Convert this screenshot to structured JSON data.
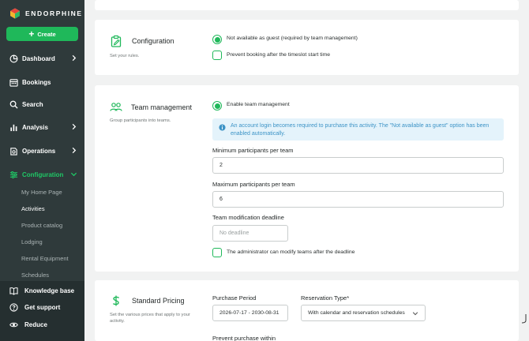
{
  "brand": {
    "name": "ENDORPHINE"
  },
  "sidebar": {
    "create_label": "Create",
    "nav": [
      {
        "label": "Dashboard",
        "icon": "dashboard-icon",
        "chevron": true
      },
      {
        "label": "Bookings",
        "icon": "calendar-icon",
        "chevron": false
      },
      {
        "label": "Search",
        "icon": "search-icon",
        "chevron": false
      },
      {
        "label": "Analysis",
        "icon": "bar-chart-icon",
        "chevron": true
      },
      {
        "label": "Operations",
        "icon": "operations-icon",
        "chevron": true
      },
      {
        "label": "Configuration",
        "icon": "sliders-icon",
        "chevron": true,
        "active": true
      }
    ],
    "sub_items": [
      "My Home Page",
      "Activities",
      "Product catalog",
      "Lodging",
      "Rental Equipment",
      "Schedules"
    ],
    "current_sub": "Activities",
    "bottom": [
      {
        "label": "Knowledge base",
        "icon": "book-icon"
      },
      {
        "label": "Get support",
        "icon": "help-icon"
      },
      {
        "label": "Reduce",
        "icon": "eye-icon"
      }
    ]
  },
  "configuration": {
    "title": "Configuration",
    "subtitle": "Set your rules.",
    "options": [
      {
        "label": "Not available as guest (required by team management)",
        "checked": true
      },
      {
        "label": "Prevent booking after the timeslot start time",
        "checked": false
      }
    ]
  },
  "team": {
    "title": "Team management",
    "subtitle": "Group participants into teams.",
    "enable_label": "Enable team management",
    "info": "An account login becomes required to purchase this activity. The \"Not available as guest\" option has been enabled automatically.",
    "min_label": "Minimum participants per team",
    "min_value": "2",
    "max_label": "Maximum participants per team",
    "max_value": "6",
    "deadline_label": "Team modification deadline",
    "deadline_placeholder": "No deadline",
    "admin_label": "The administrator can modify teams after the deadline"
  },
  "pricing": {
    "title": "Standard Pricing",
    "subtitle": "Set the various prices that apply to your activity.",
    "period_label": "Purchase Period",
    "period_value": "2026-07-17 - 2030-08-31",
    "type_label": "Reservation Type*",
    "type_value": "With calendar and reservation schedules",
    "prevent_label": "Prevent purchase within"
  },
  "colors": {
    "sidebar_bg": "#2f3a3b",
    "accent": "#1fb85a",
    "info_bg": "#e4f3fb",
    "info_text": "#3c93c6"
  }
}
